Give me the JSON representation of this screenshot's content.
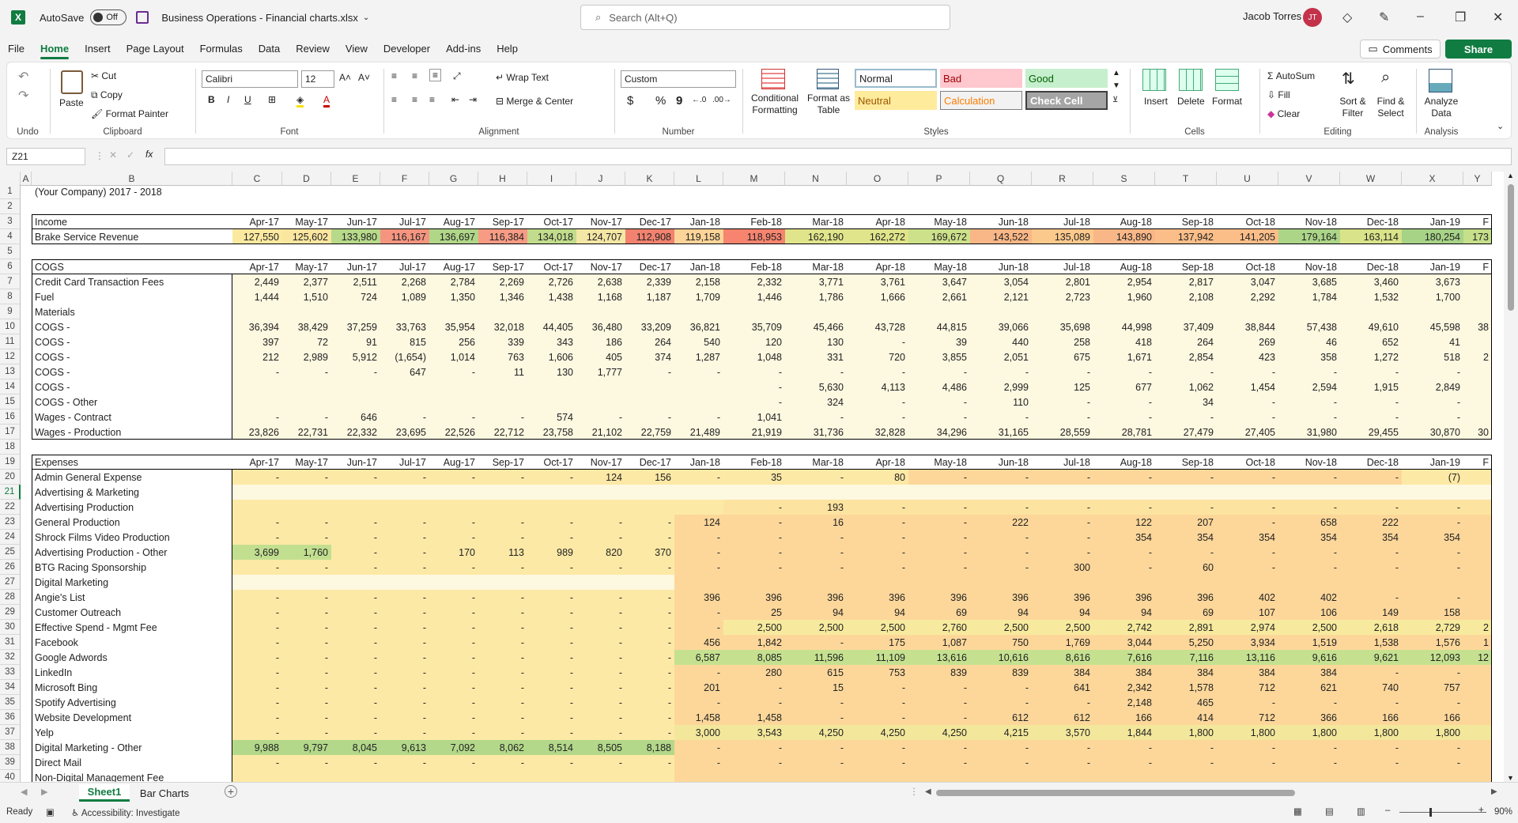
{
  "window": {
    "autosave_label": "AutoSave",
    "autosave_state": "Off",
    "file_name": "Business Operations - Financial charts.xlsx",
    "search_placeholder": "Search (Alt+Q)",
    "user_name": "Jacob Torres",
    "user_initials": "JT"
  },
  "menu": {
    "tabs": [
      "File",
      "Home",
      "Insert",
      "Page Layout",
      "Formulas",
      "Data",
      "Review",
      "View",
      "Developer",
      "Add-ins",
      "Help"
    ],
    "active": "Home",
    "comments": "Comments",
    "share": "Share"
  },
  "ribbon": {
    "undo_group": "Undo",
    "clipboard": {
      "paste": "Paste",
      "cut": "Cut",
      "copy": "Copy",
      "format_painter": "Format Painter",
      "label": "Clipboard"
    },
    "font": {
      "name": "Calibri",
      "size": "12",
      "label": "Font",
      "bold": "B",
      "italic": "I",
      "underline": "U"
    },
    "alignment": {
      "wrap": "Wrap Text",
      "merge": "Merge & Center",
      "label": "Alignment"
    },
    "number": {
      "format": "Custom",
      "currency": "$",
      "percent": "%",
      "comma": "9",
      "label": "Number"
    },
    "styles": {
      "conditional": "Conditional Formatting",
      "format_table": "Format as Table",
      "normal": "Normal",
      "bad": "Bad",
      "good": "Good",
      "neutral": "Neutral",
      "calculation": "Calculation",
      "check_cell": "Check Cell",
      "label": "Styles"
    },
    "cells": {
      "insert": "Insert",
      "delete": "Delete",
      "format": "Format",
      "label": "Cells"
    },
    "editing": {
      "autosum": "AutoSum",
      "fill": "Fill",
      "clear": "Clear",
      "sort": "Sort & Filter",
      "find": "Find & Select",
      "label": "Editing"
    },
    "analysis": {
      "analyze": "Analyze Data",
      "label": "Analysis"
    }
  },
  "formula_bar": {
    "name_box": "Z21",
    "fx": "fx",
    "content": ""
  },
  "columns": [
    "A",
    "B",
    "C",
    "D",
    "E",
    "F",
    "G",
    "H",
    "I",
    "J",
    "K",
    "L",
    "M",
    "N",
    "O",
    "P",
    "Q",
    "R",
    "S",
    "T",
    "U",
    "V",
    "W",
    "X",
    "Y"
  ],
  "months": [
    "Apr-17",
    "May-17",
    "Jun-17",
    "Jul-17",
    "Aug-17",
    "Sep-17",
    "Oct-17",
    "Nov-17",
    "Dec-17",
    "Jan-18",
    "Feb-18",
    "Mar-18",
    "Apr-18",
    "May-18",
    "Jun-18",
    "Jul-18",
    "Aug-18",
    "Sep-18",
    "Oct-18",
    "Nov-18",
    "Dec-18",
    "Jan-19",
    "F"
  ],
  "sheet": {
    "title": "(Your Company) 2017 - 2018",
    "income_label": "Income",
    "cogs_label": "COGS",
    "expenses_label": "Expenses",
    "rows": [
      {
        "r": 4,
        "label": "Brake Service Revenue",
        "values": [
          "127,550",
          "125,602",
          "133,980",
          "116,167",
          "136,697",
          "116,384",
          "134,018",
          "124,707",
          "112,908",
          "119,158",
          "118,953",
          "162,190",
          "162,272",
          "169,672",
          "143,522",
          "135,089",
          "143,890",
          "137,942",
          "141,205",
          "179,164",
          "163,114",
          "180,254",
          "173"
        ]
      },
      {
        "r": 7,
        "label": "Credit Card Transaction Fees",
        "values": [
          "2,449",
          "2,377",
          "2,511",
          "2,268",
          "2,784",
          "2,269",
          "2,726",
          "2,638",
          "2,339",
          "2,158",
          "2,332",
          "3,771",
          "3,761",
          "3,647",
          "3,054",
          "2,801",
          "2,954",
          "2,817",
          "3,047",
          "3,685",
          "3,460",
          "3,673",
          ""
        ]
      },
      {
        "r": 8,
        "label": "Fuel",
        "values": [
          "1,444",
          "1,510",
          "724",
          "1,089",
          "1,350",
          "1,346",
          "1,438",
          "1,168",
          "1,187",
          "1,709",
          "1,446",
          "1,786",
          "1,666",
          "2,661",
          "2,121",
          "2,723",
          "1,960",
          "2,108",
          "2,292",
          "1,784",
          "1,532",
          "1,700",
          ""
        ]
      },
      {
        "r": 9,
        "label": "Materials",
        "values": [
          "",
          "",
          "",
          "",
          "",
          "",
          "",
          "",
          "",
          "",
          "",
          "",
          "",
          "",
          "",
          "",
          "",
          "",
          "",
          "",
          "",
          "",
          ""
        ]
      },
      {
        "r": 10,
        "label": "COGS -",
        "values": [
          "36,394",
          "38,429",
          "37,259",
          "33,763",
          "35,954",
          "32,018",
          "44,405",
          "36,480",
          "33,209",
          "36,821",
          "35,709",
          "45,466",
          "43,728",
          "44,815",
          "39,066",
          "35,698",
          "44,998",
          "37,409",
          "38,844",
          "57,438",
          "49,610",
          "45,598",
          "38"
        ]
      },
      {
        "r": 11,
        "label": "COGS -",
        "values": [
          "397",
          "72",
          "91",
          "815",
          "256",
          "339",
          "343",
          "186",
          "264",
          "540",
          "120",
          "130",
          "-",
          "39",
          "440",
          "258",
          "418",
          "264",
          "269",
          "46",
          "652",
          "41",
          ""
        ]
      },
      {
        "r": 12,
        "label": "COGS -",
        "values": [
          "212",
          "2,989",
          "5,912",
          "(1,654)",
          "1,014",
          "763",
          "1,606",
          "405",
          "374",
          "1,287",
          "1,048",
          "331",
          "720",
          "3,855",
          "2,051",
          "675",
          "1,671",
          "2,854",
          "423",
          "358",
          "1,272",
          "518",
          "2"
        ]
      },
      {
        "r": 13,
        "label": "COGS -",
        "values": [
          "-",
          "-",
          "-",
          "647",
          "-",
          "11",
          "130",
          "1,777",
          "-",
          "-",
          "-",
          "-",
          "-",
          "-",
          "-",
          "-",
          "-",
          "-",
          "-",
          "-",
          "-",
          "-",
          ""
        ]
      },
      {
        "r": 14,
        "label": "COGS -",
        "values": [
          "",
          "",
          "",
          "",
          "",
          "",
          "",
          "",
          "",
          "",
          "-",
          "5,630",
          "4,113",
          "4,486",
          "2,999",
          "125",
          "677",
          "1,062",
          "1,454",
          "2,594",
          "1,915",
          "2,849",
          ""
        ]
      },
      {
        "r": 15,
        "label": "COGS - Other",
        "values": [
          "",
          "",
          "",
          "",
          "",
          "",
          "",
          "",
          "",
          "",
          "-",
          "324",
          "-",
          "-",
          "110",
          "-",
          "-",
          "34",
          "-",
          "-",
          "-",
          "-",
          ""
        ]
      },
      {
        "r": 16,
        "label": "Wages - Contract",
        "values": [
          "-",
          "-",
          "646",
          "-",
          "-",
          "-",
          "574",
          "-",
          "-",
          "-",
          "1,041",
          "-",
          "-",
          "-",
          "-",
          "-",
          "-",
          "-",
          "-",
          "-",
          "-",
          "-",
          ""
        ]
      },
      {
        "r": 17,
        "label": "Wages - Production",
        "values": [
          "23,826",
          "22,731",
          "22,332",
          "23,695",
          "22,526",
          "22,712",
          "23,758",
          "21,102",
          "22,759",
          "21,489",
          "21,919",
          "31,736",
          "32,828",
          "34,296",
          "31,165",
          "28,559",
          "28,781",
          "27,479",
          "27,405",
          "31,980",
          "29,455",
          "30,870",
          "30"
        ]
      },
      {
        "r": 20,
        "label": "Admin General Expense",
        "values": [
          "-",
          "-",
          "-",
          "-",
          "-",
          "-",
          "-",
          "124",
          "156",
          "-",
          "35",
          "-",
          "80",
          "-",
          "-",
          "-",
          "-",
          "-",
          "-",
          "-",
          "-",
          "(7)",
          ""
        ]
      },
      {
        "r": 21,
        "label": "Advertising & Marketing",
        "values": [
          "",
          "",
          "",
          "",
          "",
          "",
          "",
          "",
          "",
          "",
          "",
          "",
          "",
          "",
          "",
          "",
          "",
          "",
          "",
          "",
          "",
          "",
          ""
        ]
      },
      {
        "r": 22,
        "label": "Advertising Production",
        "values": [
          "",
          "",
          "",
          "",
          "",
          "",
          "",
          "",
          "",
          "",
          "-",
          "193",
          "-",
          "-",
          "-",
          "-",
          "-",
          "-",
          "-",
          "-",
          "-",
          "-",
          ""
        ]
      },
      {
        "r": 23,
        "label": "General Production",
        "values": [
          "-",
          "-",
          "-",
          "-",
          "-",
          "-",
          "-",
          "-",
          "-",
          "124",
          "-",
          "16",
          "-",
          "-",
          "222",
          "-",
          "122",
          "207",
          "-",
          "658",
          "222",
          "-",
          ""
        ]
      },
      {
        "r": 24,
        "label": "Shrock Films Video Production",
        "values": [
          "-",
          "-",
          "-",
          "-",
          "-",
          "-",
          "-",
          "-",
          "-",
          "-",
          "-",
          "-",
          "-",
          "-",
          "-",
          "-",
          "354",
          "354",
          "354",
          "354",
          "354",
          "354",
          ""
        ]
      },
      {
        "r": 25,
        "label": "Advertising Production - Other",
        "values": [
          "3,699",
          "1,760",
          "-",
          "-",
          "170",
          "113",
          "989",
          "820",
          "370",
          "-",
          "-",
          "-",
          "-",
          "-",
          "-",
          "-",
          "-",
          "-",
          "-",
          "-",
          "-",
          "-",
          ""
        ]
      },
      {
        "r": 26,
        "label": "BTG Racing Sponsorship",
        "values": [
          "-",
          "-",
          "-",
          "-",
          "-",
          "-",
          "-",
          "-",
          "-",
          "-",
          "-",
          "-",
          "-",
          "-",
          "-",
          "300",
          "-",
          "60",
          "-",
          "-",
          "-",
          "-",
          ""
        ]
      },
      {
        "r": 27,
        "label": "Digital Marketing",
        "values": [
          "",
          "",
          "",
          "",
          "",
          "",
          "",
          "",
          "",
          "",
          "",
          "",
          "",
          "",
          "",
          "",
          "",
          "",
          "",
          "",
          "",
          "",
          ""
        ]
      },
      {
        "r": 28,
        "label": "Angie's List",
        "values": [
          "-",
          "-",
          "-",
          "-",
          "-",
          "-",
          "-",
          "-",
          "-",
          "396",
          "396",
          "396",
          "396",
          "396",
          "396",
          "396",
          "396",
          "396",
          "402",
          "402",
          "-",
          "-",
          ""
        ]
      },
      {
        "r": 29,
        "label": "Customer Outreach",
        "values": [
          "-",
          "-",
          "-",
          "-",
          "-",
          "-",
          "-",
          "-",
          "-",
          "-",
          "25",
          "94",
          "94",
          "69",
          "94",
          "94",
          "94",
          "69",
          "107",
          "106",
          "149",
          "158",
          ""
        ]
      },
      {
        "r": 30,
        "label": "Effective Spend - Mgmt Fee",
        "values": [
          "-",
          "-",
          "-",
          "-",
          "-",
          "-",
          "-",
          "-",
          "-",
          "-",
          "2,500",
          "2,500",
          "2,500",
          "2,760",
          "2,500",
          "2,500",
          "2,742",
          "2,891",
          "2,974",
          "2,500",
          "2,618",
          "2,729",
          "2"
        ]
      },
      {
        "r": 31,
        "label": "Facebook",
        "values": [
          "-",
          "-",
          "-",
          "-",
          "-",
          "-",
          "-",
          "-",
          "-",
          "456",
          "1,842",
          "-",
          "175",
          "1,087",
          "750",
          "1,769",
          "3,044",
          "5,250",
          "3,934",
          "1,519",
          "1,538",
          "1,576",
          "1"
        ]
      },
      {
        "r": 32,
        "label": "Google Adwords",
        "values": [
          "-",
          "-",
          "-",
          "-",
          "-",
          "-",
          "-",
          "-",
          "-",
          "6,587",
          "8,085",
          "11,596",
          "11,109",
          "13,616",
          "10,616",
          "8,616",
          "7,616",
          "7,116",
          "13,116",
          "9,616",
          "9,621",
          "12,093",
          "12"
        ]
      },
      {
        "r": 33,
        "label": "LinkedIn",
        "values": [
          "-",
          "-",
          "-",
          "-",
          "-",
          "-",
          "-",
          "-",
          "-",
          "-",
          "280",
          "615",
          "753",
          "839",
          "839",
          "384",
          "384",
          "384",
          "384",
          "384",
          "-",
          "-",
          ""
        ]
      },
      {
        "r": 34,
        "label": "Microsoft Bing",
        "values": [
          "-",
          "-",
          "-",
          "-",
          "-",
          "-",
          "-",
          "-",
          "-",
          "201",
          "-",
          "15",
          "-",
          "-",
          "-",
          "641",
          "2,342",
          "1,578",
          "712",
          "621",
          "740",
          "757",
          ""
        ]
      },
      {
        "r": 35,
        "label": "Spotify Advertising",
        "values": [
          "-",
          "-",
          "-",
          "-",
          "-",
          "-",
          "-",
          "-",
          "-",
          "-",
          "-",
          "-",
          "-",
          "-",
          "-",
          "-",
          "2,148",
          "465",
          "-",
          "-",
          "-",
          "-",
          ""
        ]
      },
      {
        "r": 36,
        "label": "Website Development",
        "values": [
          "-",
          "-",
          "-",
          "-",
          "-",
          "-",
          "-",
          "-",
          "-",
          "1,458",
          "1,458",
          "-",
          "-",
          "-",
          "612",
          "612",
          "166",
          "414",
          "712",
          "366",
          "166",
          "166",
          ""
        ]
      },
      {
        "r": 37,
        "label": "Yelp",
        "values": [
          "-",
          "-",
          "-",
          "-",
          "-",
          "-",
          "-",
          "-",
          "-",
          "3,000",
          "3,543",
          "4,250",
          "4,250",
          "4,250",
          "4,215",
          "3,570",
          "1,844",
          "1,800",
          "1,800",
          "1,800",
          "1,800",
          "1,800",
          ""
        ]
      },
      {
        "r": 38,
        "label": "Digital Marketing - Other",
        "values": [
          "9,988",
          "9,797",
          "8,045",
          "9,613",
          "7,092",
          "8,062",
          "8,514",
          "8,505",
          "8,188",
          "-",
          "-",
          "-",
          "-",
          "-",
          "-",
          "-",
          "-",
          "-",
          "-",
          "-",
          "-",
          "-",
          ""
        ]
      },
      {
        "r": 39,
        "label": "Direct Mail",
        "values": [
          "-",
          "-",
          "-",
          "-",
          "-",
          "-",
          "-",
          "-",
          "-",
          "-",
          "-",
          "-",
          "-",
          "-",
          "-",
          "-",
          "-",
          "-",
          "-",
          "-",
          "-",
          "-",
          ""
        ]
      },
      {
        "r": 40,
        "label": "Non-Digital Management Fee",
        "values": [
          "",
          "",
          "",
          "",
          "",
          "",
          "",
          "",
          "",
          "",
          "",
          "",
          "",
          "",
          "",
          "",
          "",
          "",
          "",
          "",
          "",
          "",
          ""
        ]
      }
    ]
  },
  "heat_colors": {
    "4": [
      "#fbe9a0",
      "#fbe6a0",
      "#b7d98a",
      "#f59580",
      "#b0d688",
      "#f79b84",
      "#c1dc8c",
      "#f4e6a4",
      "#f2826f",
      "#fcd498",
      "#f6846f",
      "#e0e58b",
      "#e0e58b",
      "#cde08a",
      "#f9b787",
      "#fcc98d",
      "#f9b787",
      "#fbbe89",
      "#fbbe89",
      "#acd588",
      "#d9e389",
      "#a7d387",
      "#c6df8a"
    ]
  },
  "sheet_tabs": [
    "Sheet1",
    "Bar Charts"
  ],
  "status": {
    "ready": "Ready",
    "accessibility": "Accessibility: Investigate",
    "zoom": "90%"
  }
}
